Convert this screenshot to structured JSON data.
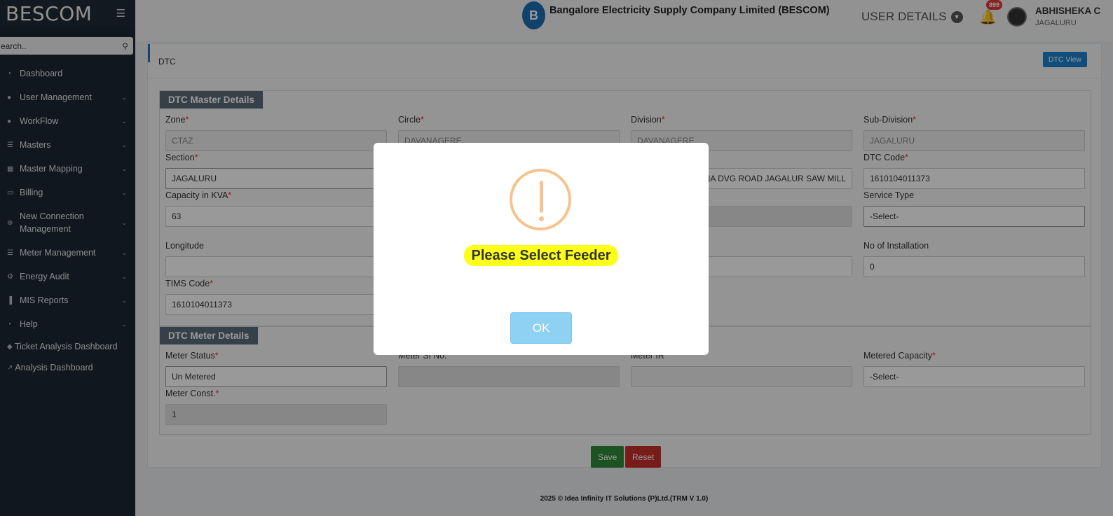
{
  "sidebar": {
    "brand": "BESCOM",
    "search_placeholder": "earch..",
    "items": [
      {
        "label": "Dashboard",
        "icon": "dashboard-icon",
        "chevron": false
      },
      {
        "label": "User Management",
        "icon": "user-icon",
        "chevron": true
      },
      {
        "label": "WorkFlow",
        "icon": "user-icon",
        "chevron": true
      },
      {
        "label": "Masters",
        "icon": "list-icon",
        "chevron": true
      },
      {
        "label": "Master Mapping",
        "icon": "sitemap-icon",
        "chevron": true
      },
      {
        "label": "Billing",
        "icon": "monitor-icon",
        "chevron": true
      },
      {
        "label": "New Connection Management",
        "icon": "plus-circle-icon",
        "chevron": true
      },
      {
        "label": "Meter Management",
        "icon": "list-icon",
        "chevron": true
      },
      {
        "label": "Energy Audit",
        "icon": "cogs-icon",
        "chevron": true
      },
      {
        "label": "MIS Reports",
        "icon": "bar-chart-icon",
        "chevron": true
      },
      {
        "label": "Help",
        "icon": "dashboard-icon",
        "chevron": true
      }
    ],
    "extra_links": [
      "Ticket Analysis Dashboard",
      "Analysis Dashboard"
    ]
  },
  "header": {
    "company": "Bangalore Electricity Supply Company Limited (BESCOM)",
    "user_details": "USER DETAILS",
    "notif_count": "899",
    "user_name": "ABHISHEKA C",
    "user_location": "JAGALURU"
  },
  "page": {
    "title": "DTC",
    "dtc_view_label": "DTC View"
  },
  "master": {
    "panel_title": "DTC Master Details",
    "zone": {
      "label": "Zone",
      "value": "CTAZ"
    },
    "circle": {
      "label": "Circle",
      "value": "DAVANAGERE"
    },
    "division": {
      "label": "Division",
      "value": "DAVANAGERE"
    },
    "sub_division": {
      "label": "Sub-Division",
      "value": "JAGALURU"
    },
    "section": {
      "label": "Section",
      "value": "JAGALURU"
    },
    "dtc_name_partial": "ANNA DVG ROAD JAGALUR SAW MILL",
    "dtc_code": {
      "label": "DTC Code",
      "value": "1610104011373"
    },
    "capacity": {
      "label": "Capacity in KVA",
      "value": "63"
    },
    "service_type": {
      "label": "Service Type",
      "value": "-Select-"
    },
    "longitude": {
      "label": "Longitude",
      "value": ""
    },
    "installations": {
      "label": "No of Installation",
      "value": "0"
    },
    "tims_code": {
      "label": "TIMS Code",
      "value": "1610104011373"
    }
  },
  "meter": {
    "panel_title": "DTC Meter Details",
    "status": {
      "label": "Meter Status",
      "value": "Un Metered"
    },
    "serial": {
      "label": "Meter Sl No.",
      "value": ""
    },
    "mr": {
      "label": "Meter IR",
      "value": ""
    },
    "metered_capacity": {
      "label": "Metered Capacity",
      "value": "-Select-"
    },
    "const": {
      "label": "Meter Const.",
      "value": "1"
    }
  },
  "actions": {
    "save": "Save",
    "reset": "Reset"
  },
  "footer": "2025 © Idea Infinity IT Solutions (P)Ltd.(TRM V 1.0)",
  "modal": {
    "message": "Please Select Feeder",
    "ok_label": "OK"
  },
  "colors": {
    "sidebar": "#1c2733",
    "accent": "#1e83cf",
    "warning": "#f6c38f",
    "highlight": "#fbff1a"
  }
}
